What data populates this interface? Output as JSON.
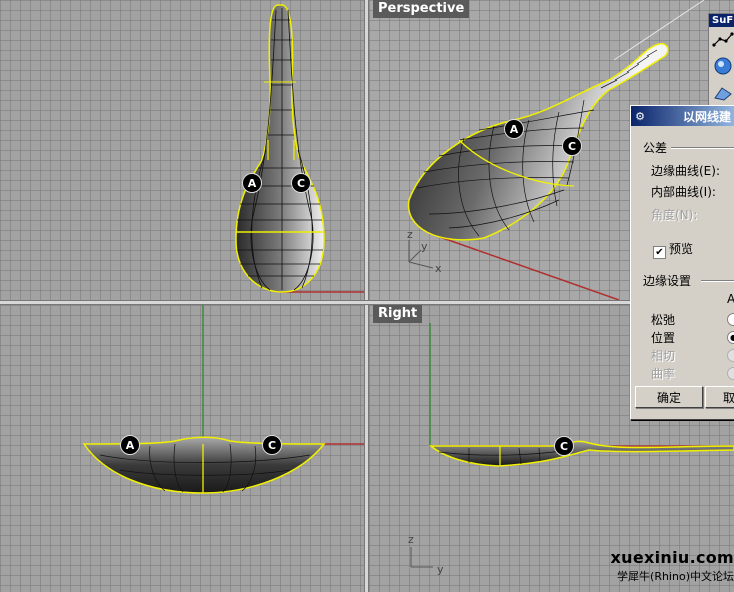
{
  "viewports": {
    "perspective": {
      "title": "Perspective"
    },
    "right": {
      "title": "Right"
    }
  },
  "markers": {
    "a": "A",
    "c": "C"
  },
  "axes": {
    "x": "x",
    "y": "y",
    "z": "z"
  },
  "toolbar": {
    "title": "SuF",
    "icons": [
      "curve-network-icon",
      "sphere-icon",
      "surface-tool-icon"
    ]
  },
  "dialog": {
    "title": "以网线建",
    "section_tolerance": "公差",
    "edge_curves_label": "边缘曲线(E):",
    "inner_curves_label": "内部曲线(I):",
    "angle_label": "角度(N):",
    "preview_label": "预览",
    "preview_checked": true,
    "section_edge": "边缘设置",
    "column_letter": "A",
    "options": [
      {
        "label": "松弛",
        "enabled": true,
        "selected": false
      },
      {
        "label": "位置",
        "enabled": true,
        "selected": true
      },
      {
        "label": "相切",
        "enabled": false,
        "selected": false
      },
      {
        "label": "曲率",
        "enabled": false,
        "selected": false
      }
    ],
    "ok_label": "确定",
    "cancel_label": "取消"
  },
  "watermark": {
    "url": "xuexiniu.com",
    "subtitle": "学犀牛(Rhino)中文论坛"
  }
}
